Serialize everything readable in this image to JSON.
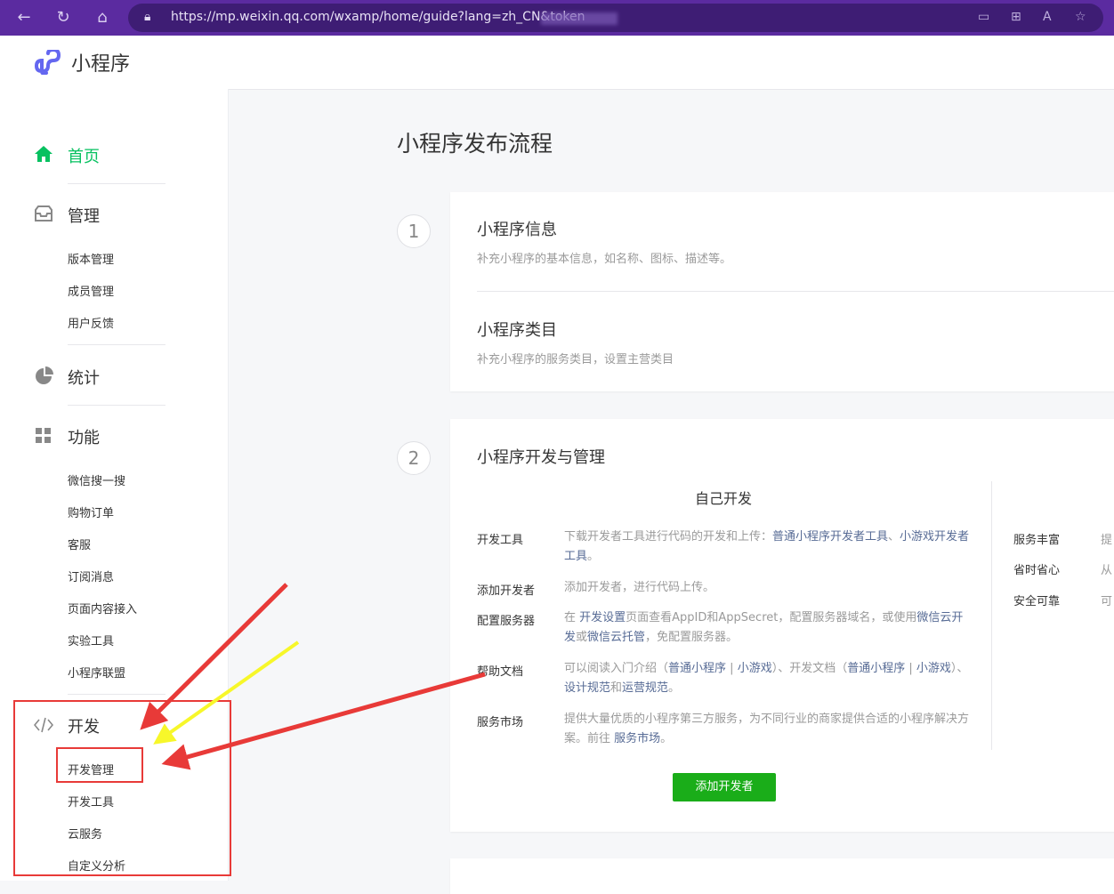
{
  "browser": {
    "url": "https://mp.weixin.qq.com/wxamp/home/guide?lang=zh_CN&token",
    "icons": [
      "back-icon",
      "refresh-icon",
      "home-icon",
      "lock-icon",
      "screen-icon",
      "grid-icon",
      "read-aloud-icon",
      "favorite-icon"
    ]
  },
  "app": {
    "name": "小程序"
  },
  "sidebar": {
    "home": "首页",
    "manage": "管理",
    "manage_items": [
      "版本管理",
      "成员管理",
      "用户反馈"
    ],
    "stats": "统计",
    "features": "功能",
    "feature_items": [
      "微信搜一搜",
      "购物订单",
      "客服",
      "订阅消息",
      "页面内容接入",
      "实验工具",
      "小程序联盟"
    ],
    "dev": "开发",
    "dev_items": [
      "开发管理",
      "开发工具",
      "云服务",
      "自定义分析"
    ],
    "active_color": "#07c160"
  },
  "main": {
    "title": "小程序发布流程",
    "step1": {
      "num": "1",
      "info_title": "小程序信息",
      "info_desc": "补充小程序的基本信息，如名称、图标、描述等。",
      "cat_title": "小程序类目",
      "cat_desc": "补充小程序的服务类目，设置主营类目"
    },
    "step2": {
      "num": "2",
      "title": "小程序开发与管理",
      "self_dev": "自己开发",
      "rows": [
        {
          "label": "开发工具",
          "t1": "下载开发者工具进行代码的开发和上传：",
          "l1": "普通小程序开发者工具",
          "t2": "、",
          "l2": "小游戏开发者工具",
          "t3": "。"
        },
        {
          "label": "添加开发者",
          "t1": "添加开发者，进行代码上传。"
        },
        {
          "label": "配置服务器",
          "t1": "在 ",
          "l1": "开发设置",
          "t2": "页面查看AppID和AppSecret，配置服务器域名，或使用",
          "l2": "微信云开发",
          "t3": "或",
          "l3": "微信云托管",
          "t4": "，免配置服务器。"
        },
        {
          "label": "帮助文档",
          "t1": "可以阅读入门介绍（",
          "l1": "普通小程序",
          "t2": " | ",
          "l2": "小游戏",
          "t3": "）、开发文档（",
          "l3": "普通小程序",
          "t4": " | ",
          "l4": "小游戏",
          "t5": "）、",
          "l5": "设计规范",
          "t6": "和",
          "l6": "运营规范",
          "t7": "。"
        },
        {
          "label": "服务市场",
          "t1": "提供大量优质的小程序第三方服务，为不同行业的商家提供合适的小程序解决方案。前往 ",
          "l1": "服务市场",
          "t2": "。"
        }
      ],
      "right_rows": [
        {
          "label": "服务丰富",
          "text": "提"
        },
        {
          "label": "省时省心",
          "text": "从"
        },
        {
          "label": "安全可靠",
          "text": "可"
        }
      ],
      "add_button": "添加开发者"
    }
  },
  "colors": {
    "brand_purple": "#5b2ba0",
    "green": "#1aad19",
    "link": "#576b95",
    "annotation_red": "#e83a38",
    "annotation_yellow": "#f7f72a"
  }
}
